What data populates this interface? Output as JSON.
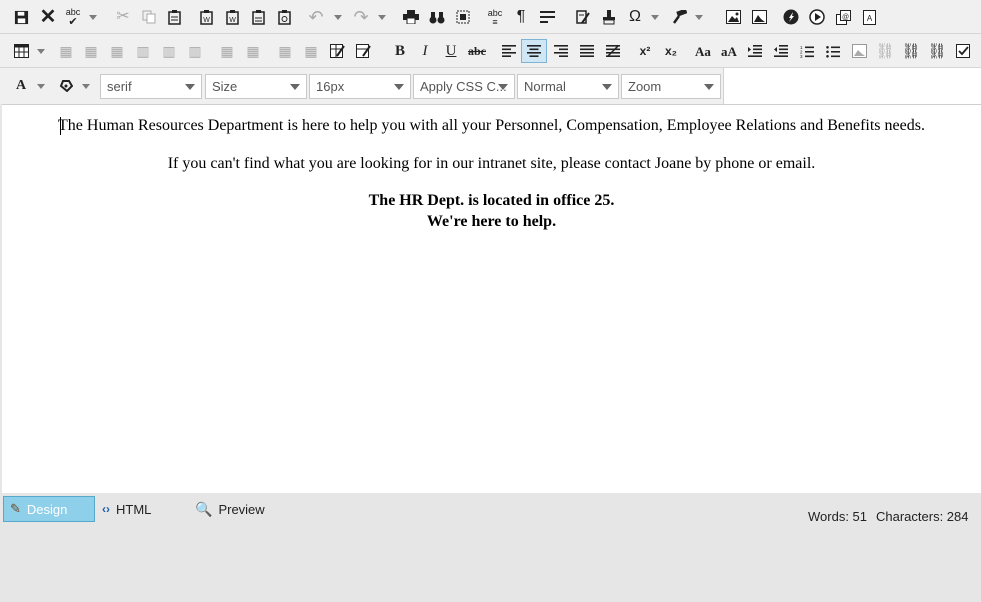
{
  "editor": {
    "paragraph1": "The Human Resources Department is here to help you with all your Personnel, Compensation, Employee Relations and Benefits needs.",
    "paragraph2": "If you can't find what you are looking for in our intranet site, please contact Joane by phone or email.",
    "paragraph3_line1": "The HR Dept. is located in office 25.",
    "paragraph3_line2": "We're here to help."
  },
  "toolbar": {
    "format_buttons": {
      "bold": "B",
      "italic": "I",
      "underline": "U",
      "strikethrough": "abc",
      "superscript": "x²",
      "subscript": "x₂",
      "case1": "Aa",
      "case2": "aA",
      "omega": "Ω",
      "font_color": "A",
      "spellcheck": "abc"
    },
    "selects": {
      "font_name": "serif",
      "font_size": "Size",
      "real_font_size": "16px",
      "css_class": "Apply CSS C...",
      "paragraph": "Normal",
      "zoom": "Zoom"
    }
  },
  "modes": {
    "design": "Design",
    "html": "HTML",
    "preview": "Preview"
  },
  "status": {
    "words": "Words: 51",
    "characters": "Characters: 284"
  },
  "colors": {
    "active_tab": "#8ed0ea",
    "toolbar_bg": "#f0f0f0",
    "editor_bg": "#ffffff"
  }
}
